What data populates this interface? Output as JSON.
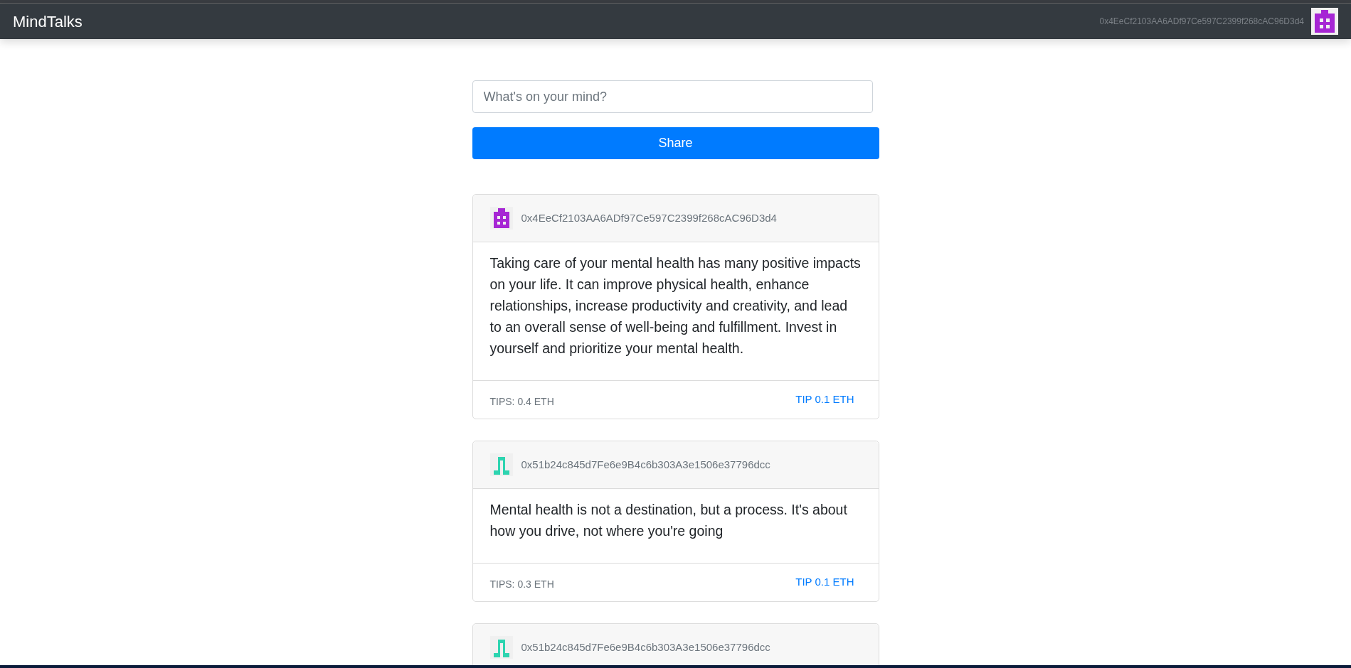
{
  "navbar": {
    "brand": "MindTalks",
    "account": "0x4EeCf2103AA6ADf97Ce597C2399f268cAC96D3d4",
    "avatar": {
      "kind": "blocks",
      "color": "#a626d4"
    }
  },
  "composer": {
    "placeholder": "What's on your mind?",
    "button": "Share"
  },
  "posts": [
    {
      "author": "0x4EeCf2103AA6ADf97Ce597C2399f268cAC96D3d4",
      "avatar": {
        "kind": "blocks",
        "color": "#a626d4"
      },
      "content": "Taking care of your mental health has many positive impacts on your life. It can improve physical health, enhance relationships, increase productivity and creativity, and lead to an overall sense of well-being and fulfillment. Invest in yourself and prioritize your mental health.",
      "tips": "TIPS: 0.4 ETH",
      "tip_button": "TIP 0.1 ETH"
    },
    {
      "author": "0x51b24c845d7Fe6e9B4c6b303A3e1506e37796dcc",
      "avatar": {
        "kind": "arch",
        "color": "#2dd4b0"
      },
      "content": "Mental health is not a destination, but a process. It's about how you drive, not where you're going",
      "tips": "TIPS: 0.3 ETH",
      "tip_button": "TIP 0.1 ETH"
    },
    {
      "author": "0x51b24c845d7Fe6e9B4c6b303A3e1506e37796dcc",
      "avatar": {
        "kind": "arch",
        "color": "#2dd4b0"
      }
    }
  ]
}
